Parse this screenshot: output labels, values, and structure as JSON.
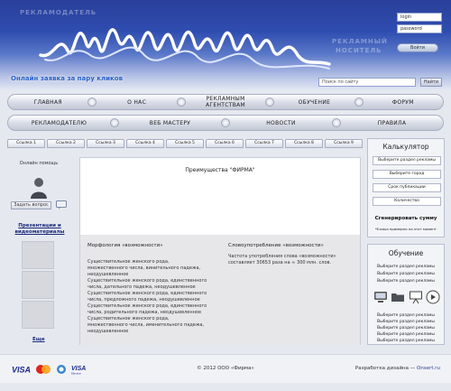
{
  "header": {
    "ghost_text_left": "РЕКЛАМОДАТЕЛЬ",
    "ghost_text_right_1": "РЕКЛАМНЫЙ",
    "ghost_text_right_2": "НОСИТЕЛЬ",
    "promo": "Онлайн заявка за пару кликов",
    "login_placeholder": "login",
    "password_placeholder": "password",
    "enter_label": "Войти",
    "search_placeholder": "Поиск по сайту",
    "search_button": "Найти"
  },
  "nav1": [
    "ГЛАВНАЯ",
    "О НАС",
    "РЕКЛАМНЫМ АГЕНТСТВАМ",
    "ОБУЧЕНИЕ",
    "ФОРУМ"
  ],
  "nav2": [
    "РЕКЛАМОДАТЕЛЮ",
    "ВЕБ МАСТЕРУ",
    "НОВОСТИ",
    "ПРАВИЛА"
  ],
  "links": [
    "Ссылка 1",
    "Ссылка 2",
    "Ссылка 3",
    "Ссылка 4",
    "Ссылка 5",
    "Ссылка 6",
    "Ссылка 7",
    "Ссылка 8",
    "Ссылка 9"
  ],
  "left": {
    "help_title": "Онлайн помощь",
    "ask_button": "Задать вопрос",
    "presentations": "Презентации и видеоматериалы",
    "more": "Еще"
  },
  "center": {
    "title": "Преимущества \"ФИРМА\"",
    "col1_title": "Морфология «возможности»",
    "col1_text": [
      "Существительное женского рода,",
      "множественного числа, винительного падежа,",
      "неодушевленное",
      "Существительное женского рода, единственного",
      "числа, дательного падежа, неодушевленное",
      "Существительное женского рода, единственного",
      "числа, предложного падежа, неодушевленное",
      "Существительное женского рода, единственного",
      "числа, родительного падежа, неодушевленное",
      "Существительное женского рода,",
      "множественного числа, именительного падежа,",
      "неодушевленное"
    ],
    "col2_title": "Словоупотребление «возможности»",
    "col2_text": [
      "Частота употребления слова «возможности»",
      "составляет 30653 раза на ≈ 300 млн. слов."
    ]
  },
  "calculator": {
    "title": "Калькулятор",
    "fields": [
      "Выберите раздел рекламы",
      "Выберите город",
      "Срок публикации",
      "Количество"
    ],
    "generate": "Сгенерировать сумму",
    "note": "*Ежаьа примерно на этот момент"
  },
  "education": {
    "title": "Обучение",
    "links_top": [
      "Выберите раздел рекламы",
      "Выберите раздел рекламы",
      "Выберите раздел рекламы"
    ],
    "links_bottom": [
      "Выберите раздел рекламы",
      "Выберите раздел рекламы",
      "Выберите раздел рекламы",
      "Выберите раздел рекламы",
      "Выберите раздел рекламы"
    ]
  },
  "footer": {
    "copyright": "© 2012 ООО «Фирма»",
    "dev_text": "Разработка дизайна — ",
    "dev_link": "Onsert.ru",
    "cards": [
      "VISA",
      "MasterCard",
      "WebMoney",
      "VISA Electron"
    ]
  },
  "colors": {
    "header_top": "#2a3f9a",
    "accent_link": "#1a2c7a",
    "promo": "#2b63c9"
  }
}
